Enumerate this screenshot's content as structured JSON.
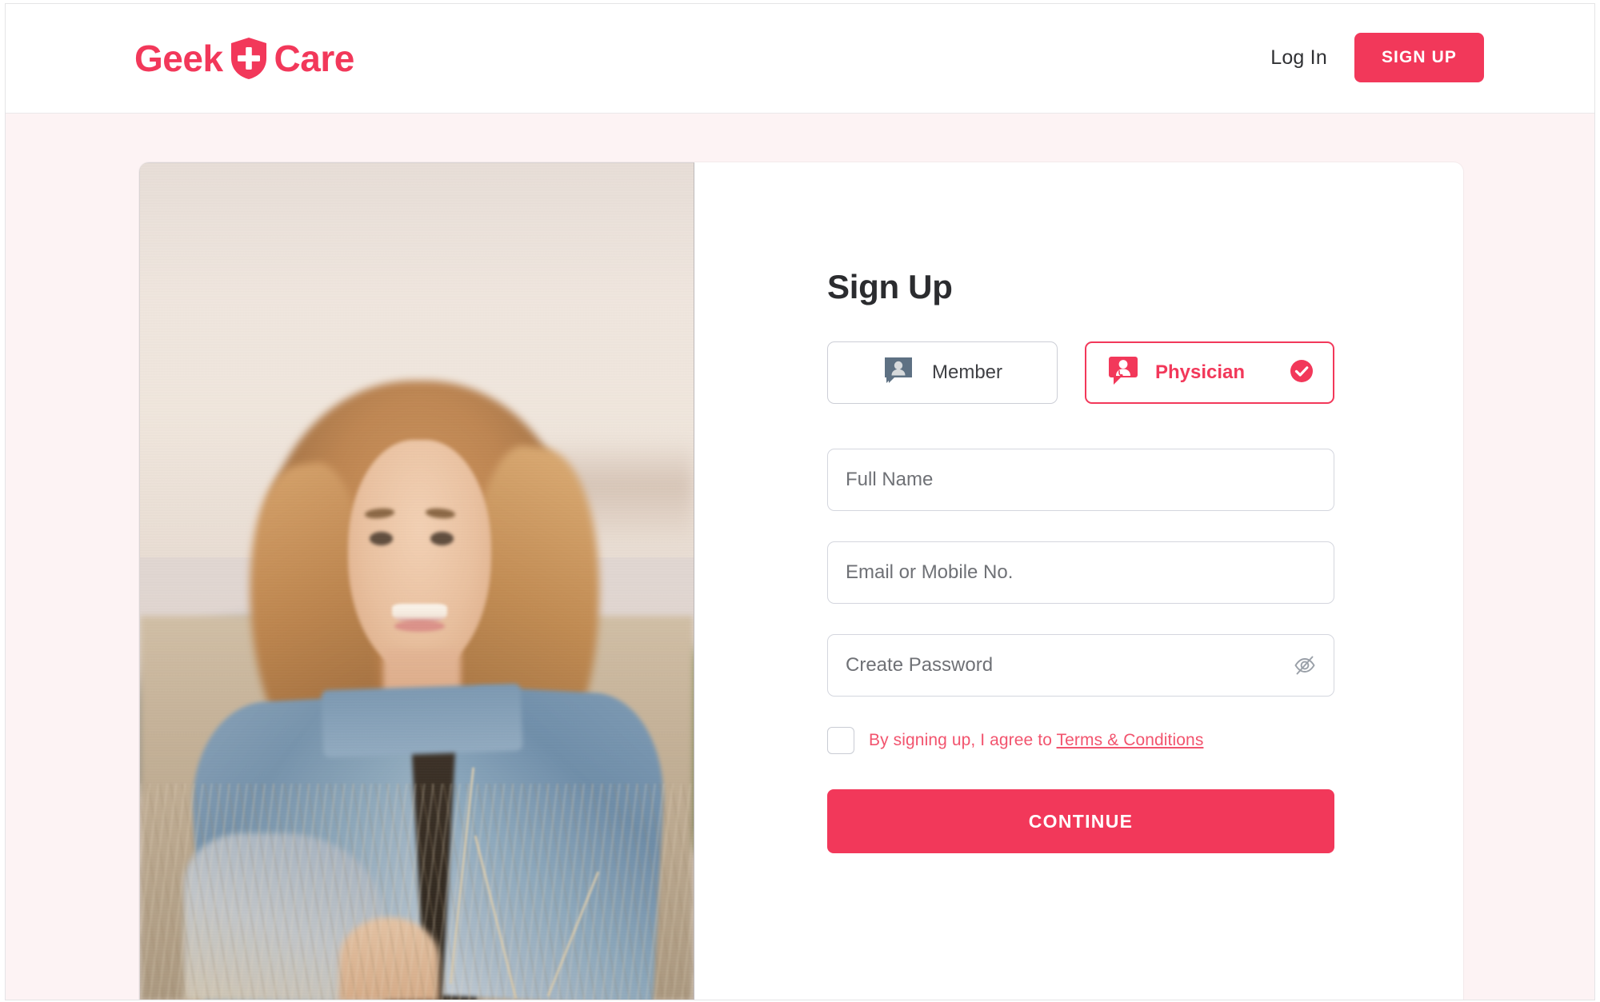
{
  "brand": {
    "name_part1": "Geek",
    "name_part2": "Care",
    "accent_color": "#F2385A",
    "logo_icon": "shield-plus-icon"
  },
  "header": {
    "login_label": "Log In",
    "signup_label": "SIGN UP"
  },
  "form": {
    "title": "Sign Up",
    "roles": [
      {
        "label": "Member",
        "icon": "person-chat-icon",
        "selected": false
      },
      {
        "label": "Physician",
        "icon": "doctor-chat-icon",
        "selected": true,
        "check_icon": "check-circle-icon"
      }
    ],
    "fields": [
      {
        "name": "full-name",
        "placeholder": "Full Name",
        "value": ""
      },
      {
        "name": "email-or-mobile",
        "placeholder": "Email or Mobile No.",
        "value": ""
      },
      {
        "name": "create-password",
        "placeholder": "Create Password",
        "value": "",
        "toggle_icon": "eye-off-icon"
      }
    ],
    "terms": {
      "checked": false,
      "text": "By signing up, I agree to ",
      "link_label": "Terms & Conditions"
    },
    "submit_label": "CONTINUE"
  },
  "photo": {
    "alt": "Smiling woman in denim jacket standing in a grass field at sunset"
  }
}
